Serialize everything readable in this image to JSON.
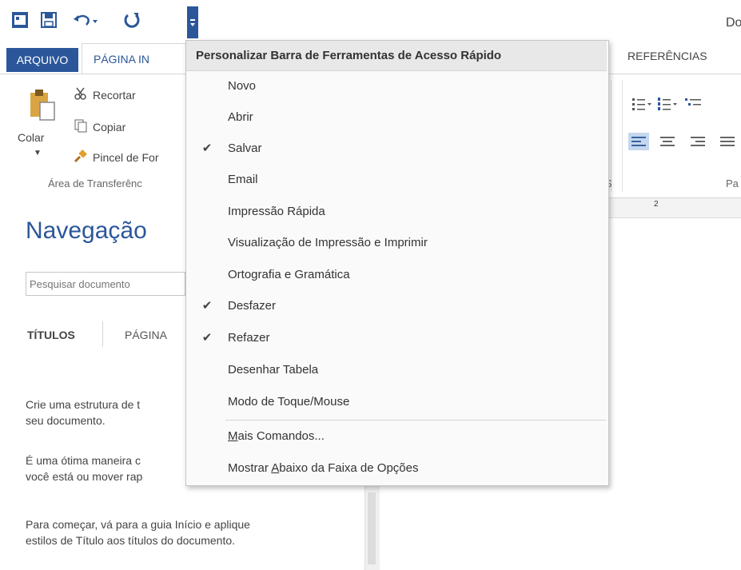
{
  "title_bar": {
    "doc_title": "Do"
  },
  "tabs": {
    "arquivo": "ARQUIVO",
    "pagina": "PÁGINA IN",
    "referencias": "REFERÊNCIAS"
  },
  "clipboard": {
    "paste": "Colar",
    "cut": "Recortar",
    "copy": "Copiar",
    "painter": "Pincel de For",
    "group": "Área de Transferênc"
  },
  "ribbon": {
    "group_s": "S",
    "group_para": "Pa"
  },
  "ruler": {
    "mark": "2"
  },
  "navigation": {
    "title": "Navegação",
    "search_placeholder": "Pesquisar documento",
    "tab_titulos": "TÍTULOS",
    "tab_paginas": "PÁGINA",
    "p1_line1": "Crie uma estrutura de t",
    "p1_line2": "seu documento.",
    "p2_line1": "É uma ótima maneira c",
    "p2_line2": "você está ou mover rap",
    "p3_line1": "Para começar, vá para a guia Início e aplique",
    "p3_line2": "estilos de Título aos títulos do documento."
  },
  "menu": {
    "header": "Personalizar Barra de Ferramentas de Acesso Rápido",
    "items": [
      {
        "label": "Novo",
        "checked": false
      },
      {
        "label": "Abrir",
        "checked": false
      },
      {
        "label": "Salvar",
        "checked": true
      },
      {
        "label": "Email",
        "checked": false
      },
      {
        "label": "Impressão Rápida",
        "checked": false
      },
      {
        "label": "Visualização de Impressão e Imprimir",
        "checked": false
      },
      {
        "label": "Ortografia e Gramática",
        "checked": false
      },
      {
        "label": "Desfazer",
        "checked": true
      },
      {
        "label": "Refazer",
        "checked": true
      },
      {
        "label": "Desenhar Tabela",
        "checked": false
      },
      {
        "label": "Modo de Toque/Mouse",
        "checked": false
      }
    ],
    "more_commands_prefix": "M",
    "more_commands_rest": "ais Comandos...",
    "show_below_prefix": "Mostrar ",
    "show_below_key": "A",
    "show_below_rest": "baixo da Faixa de Opções"
  },
  "colors": {
    "accent": "#2b579a",
    "menu_bg": "#fafafa"
  }
}
